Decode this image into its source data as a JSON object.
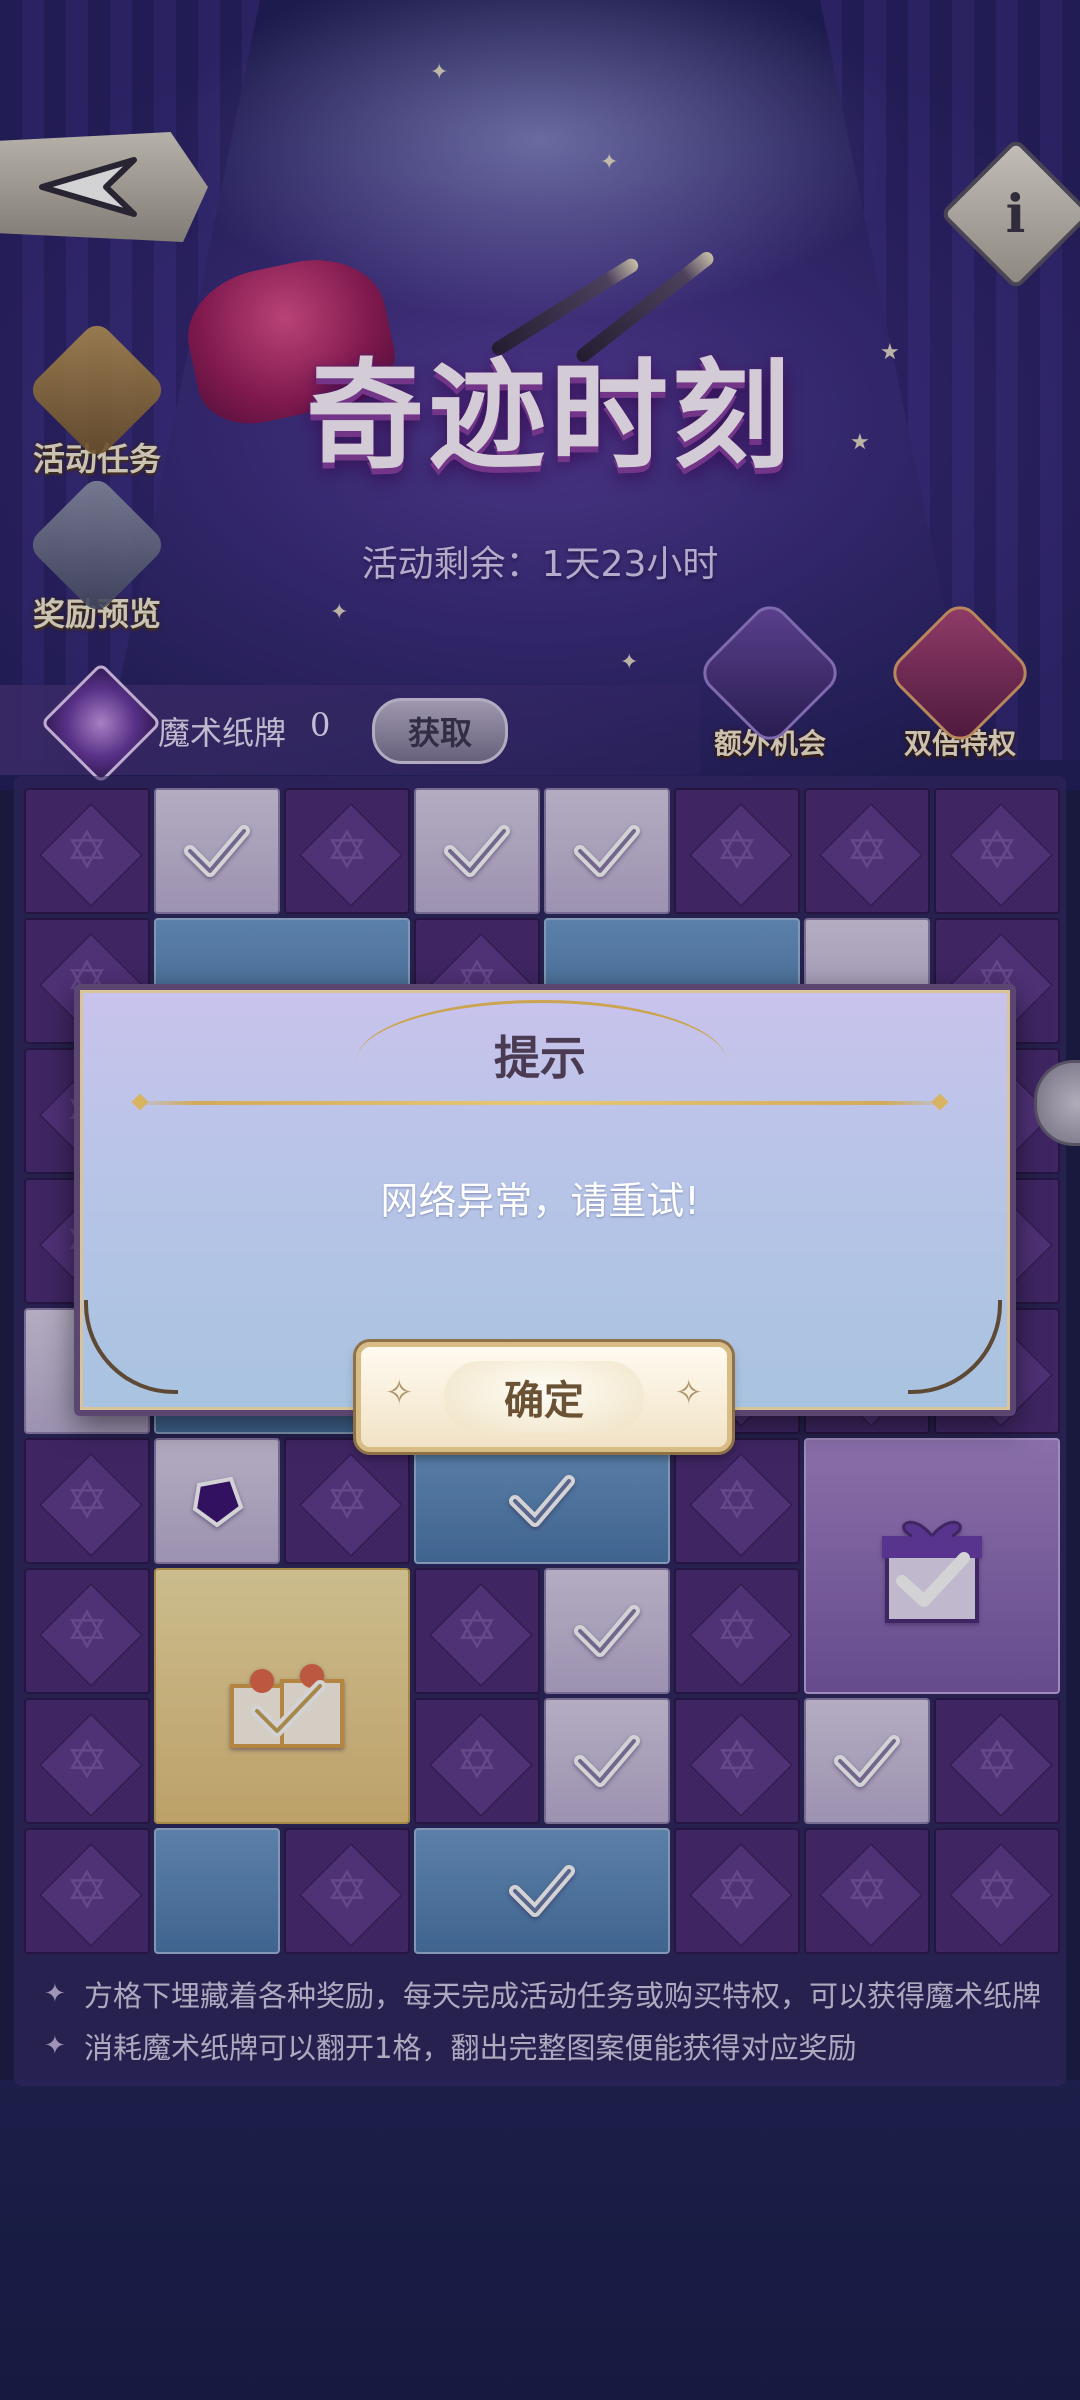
{
  "event": {
    "title": "奇迹时刻",
    "countdown": "活动剩余：1天23小时"
  },
  "nav": {
    "back_icon": "back-arrow-icon",
    "info_glyph": "i"
  },
  "side_menu": [
    {
      "label": "活动任务",
      "icon": "scroll-icon"
    },
    {
      "label": "奖励预览",
      "icon": "gift-box-icon"
    }
  ],
  "cards": {
    "label": "魔术纸牌",
    "count": "0",
    "get_label": "获取"
  },
  "perks": [
    {
      "label": "额外机会",
      "icon": "bunny-hat-icon"
    },
    {
      "label": "双倍特权",
      "icon": "gold-bunny-hat-icon"
    }
  ],
  "tips": [
    "方格下埋藏着各种奖励，每天完成活动任务或购买特权，可以获得魔术纸牌",
    "消耗魔术纸牌可以翻开1格，翻出完整图案便能获得对应奖励"
  ],
  "dialog": {
    "title": "提示",
    "message": "网络异常，请重试!",
    "confirm_label": "确定"
  },
  "colors": {
    "accent_gold": "#d1ab58",
    "tile_hidden": "#4b2c73",
    "background": "#1b1d44"
  }
}
